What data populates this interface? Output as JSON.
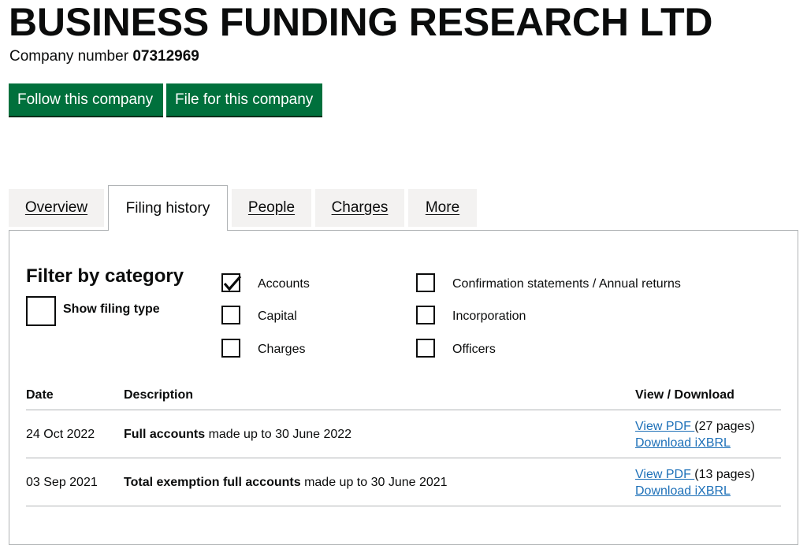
{
  "company": {
    "name": "BUSINESS FUNDING RESEARCH LTD",
    "number_label": "Company number",
    "number": "07312969"
  },
  "actions": {
    "follow": "Follow this company",
    "file": "File for this company"
  },
  "tabs": [
    {
      "label": "Overview",
      "active": false
    },
    {
      "label": "Filing history",
      "active": true
    },
    {
      "label": "People",
      "active": false
    },
    {
      "label": "Charges",
      "active": false
    },
    {
      "label": "More",
      "active": false
    }
  ],
  "filter": {
    "heading": "Filter by category",
    "show_filing_type": {
      "label": "Show filing type",
      "checked": false
    },
    "categories": [
      {
        "label": "Accounts",
        "checked": true
      },
      {
        "label": "Capital",
        "checked": false
      },
      {
        "label": "Charges",
        "checked": false
      },
      {
        "label": "Confirmation statements / Annual returns",
        "checked": false
      },
      {
        "label": "Incorporation",
        "checked": false
      },
      {
        "label": "Officers",
        "checked": false
      }
    ]
  },
  "table": {
    "headers": {
      "date": "Date",
      "description": "Description",
      "view": "View / Download"
    },
    "rows": [
      {
        "date": "24 Oct 2022",
        "desc_bold": "Full accounts",
        "desc_rest": " made up to 30 June 2022",
        "view_link": "View PDF ",
        "pages": "(27 pages)",
        "download": "Download iXBRL"
      },
      {
        "date": "03 Sep 2021",
        "desc_bold": "Total exemption full accounts",
        "desc_rest": " made up to 30 June 2021",
        "view_link": "View PDF ",
        "pages": "(13 pages)",
        "download": "Download iXBRL"
      }
    ]
  },
  "colors": {
    "button": "#00703c",
    "link": "#1d70b8",
    "tab_bg": "#f3f2f1",
    "border": "#b1b4b6"
  }
}
